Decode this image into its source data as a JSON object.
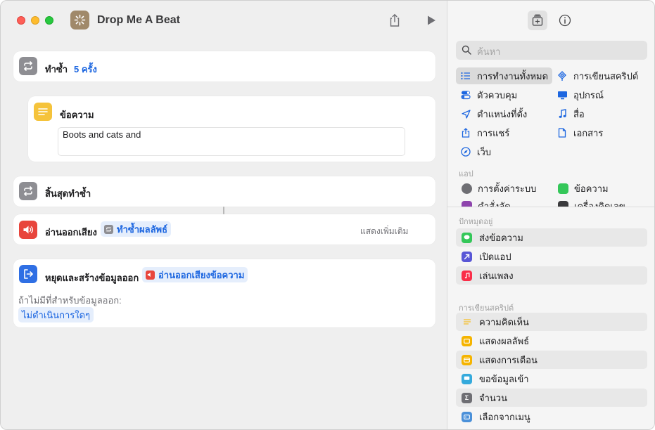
{
  "window": {
    "title": "Drop Me A Beat"
  },
  "editor": {
    "repeat": {
      "title": "ทำซ้ำ",
      "count": "5 ครั้ง"
    },
    "text_action": {
      "title": "ข้อความ",
      "value": "Boots and cats and"
    },
    "end_repeat": {
      "title": "สิ้นสุดทำซ้ำ"
    },
    "speak": {
      "title": "อ่านออกเสียง",
      "token": "ทำซ้ำผลลัพธ์",
      "show_more": "แสดงเพิ่มเติม"
    },
    "stop_output": {
      "title": "หยุดและสร้างข้อมูลออก",
      "token": "อ่านออกเสียงข้อความ",
      "if_no_output_label": "ถ้าไม่มีที่สำหรับข้อมูลออก:",
      "fallback": "ไม่ดำเนินการใดๆ"
    }
  },
  "sidebar": {
    "search_placeholder": "ค้นหา",
    "categories": [
      {
        "label": "การทำงานทั้งหมด",
        "icon": "list-icon",
        "selected": true
      },
      {
        "label": "การเขียนสคริปต์",
        "icon": "scripting-icon"
      },
      {
        "label": "ตัวควบคุม",
        "icon": "controls-icon"
      },
      {
        "label": "อุปกรณ์",
        "icon": "device-icon"
      },
      {
        "label": "ตำแหน่งที่ตั้ง",
        "icon": "location-icon"
      },
      {
        "label": "สื่อ",
        "icon": "music-note-icon"
      },
      {
        "label": "การแชร์",
        "icon": "share-icon"
      },
      {
        "label": "เอกสาร",
        "icon": "document-icon"
      },
      {
        "label": "เว็บ",
        "icon": "compass-icon"
      }
    ],
    "apps_label": "แอป",
    "apps": [
      {
        "label": "การตั้งค่าระบบ",
        "color": "#6e6e73"
      },
      {
        "label": "ข้อความ",
        "color": "#34c759"
      },
      {
        "label": "คำสั่งลัด",
        "color": "#8e44ad"
      },
      {
        "label": "เครื่องคิดเลข",
        "color": "#3a3a3c"
      }
    ],
    "pinned_label": "ปักหมุดอยู่",
    "pinned": [
      {
        "label": "ส่งข้อความ",
        "color": "#34c759"
      },
      {
        "label": "เปิดแอป",
        "color": "#5856d6"
      },
      {
        "label": "เล่นเพลง",
        "color": "#fa2d48"
      }
    ],
    "scripting_label": "การเขียนสคริปต์",
    "scripting": [
      {
        "label": "ความคิดเห็น",
        "color": "#f5c33b"
      },
      {
        "label": "แสดงผลลัพธ์",
        "color": "#f5b400"
      },
      {
        "label": "แสดงการเตือน",
        "color": "#f5b400"
      },
      {
        "label": "ขอข้อมูลเข้า",
        "color": "#35aadc"
      },
      {
        "label": "จำนวน",
        "color": "#6e6e73"
      },
      {
        "label": "เลือกจากเมนู",
        "color": "#4a90d9"
      }
    ]
  }
}
